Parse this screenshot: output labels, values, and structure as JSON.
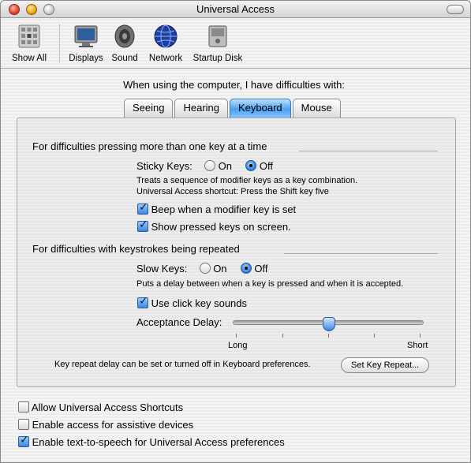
{
  "window": {
    "title": "Universal Access"
  },
  "toolbar": {
    "items": [
      {
        "label": "Show All",
        "icon": "show-all-icon"
      },
      {
        "label": "Displays",
        "icon": "display-icon"
      },
      {
        "label": "Sound",
        "icon": "speaker-icon"
      },
      {
        "label": "Network",
        "icon": "globe-icon"
      },
      {
        "label": "Startup Disk",
        "icon": "disk-icon"
      }
    ]
  },
  "prompt": "When using the computer, I have difficulties with:",
  "tabs": [
    {
      "label": "Seeing",
      "active": false
    },
    {
      "label": "Hearing",
      "active": false
    },
    {
      "label": "Keyboard",
      "active": true
    },
    {
      "label": "Mouse",
      "active": false
    }
  ],
  "keyboard": {
    "sticky": {
      "section_title": "For difficulties pressing more than one key at a time",
      "label": "Sticky Keys:",
      "on_label": "On",
      "off_label": "Off",
      "selected": "Off",
      "desc1": "Treats a sequence of modifier keys as a key combination.",
      "desc2": "Universal Access shortcut:  Press the Shift key five",
      "beep_label": "Beep when a modifier key is set",
      "beep_checked": true,
      "show_label": "Show pressed keys on screen.",
      "show_checked": true
    },
    "slow": {
      "section_title": "For difficulties with keystrokes being repeated",
      "label": "Slow Keys:",
      "on_label": "On",
      "off_label": "Off",
      "selected": "Off",
      "desc": "Puts a delay between when a key is pressed and when it is accepted.",
      "click_label": "Use click key sounds",
      "click_checked": true,
      "delay_label": "Acceptance Delay:",
      "delay_min_label": "Long",
      "delay_max_label": "Short",
      "delay_value": 0.5
    },
    "repeat_text": "Key repeat delay can be set or turned off in Keyboard preferences.",
    "repeat_button": "Set Key Repeat..."
  },
  "footer": {
    "shortcuts_label": "Allow Universal Access Shortcuts",
    "shortcuts_checked": false,
    "assistive_label": "Enable access for assistive devices",
    "assistive_checked": false,
    "tts_label": "Enable text-to-speech for Universal Access preferences",
    "tts_checked": true
  },
  "colors": {
    "accent": "#3b86e0"
  }
}
